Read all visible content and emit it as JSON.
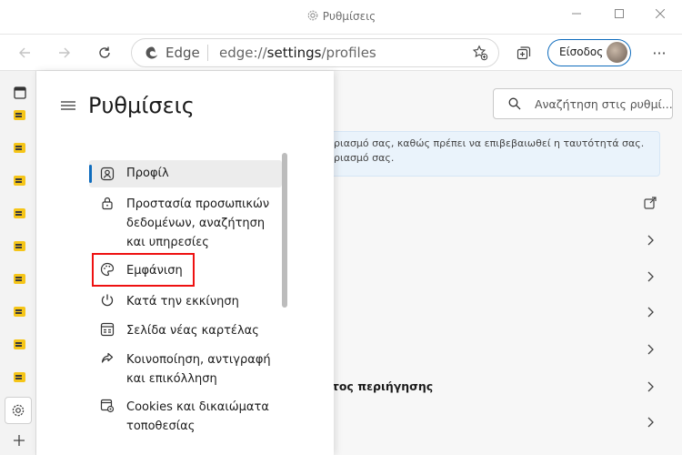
{
  "window": {
    "title": "Ρυθμίσεις"
  },
  "toolbar": {
    "address_brand": "Edge",
    "url_prefix": "edge://",
    "url_main": "settings",
    "url_suffix": "/profiles",
    "signin_label": "Είσοδος"
  },
  "settings": {
    "title": "Ρυθμίσεις",
    "search_placeholder": "Αναζήτηση στις ρυθμί...",
    "info_line1": "ριασμό σας, καθώς πρέπει να επιβεβαιωθεί η ταυτότητά σας.",
    "info_line2": "ριασμό σας.",
    "browsing_text": "ιτος περιήγησης"
  },
  "menu": {
    "items": [
      {
        "label": "Προφίλ",
        "icon": "profile-icon",
        "selected": true
      },
      {
        "label": "Προστασία προσωπικών δεδομένων, αναζήτηση και υπηρεσίες",
        "icon": "lock-icon"
      },
      {
        "label": "Εμφάνιση",
        "icon": "palette-icon",
        "highlighted": true
      },
      {
        "label": "Κατά την εκκίνηση",
        "icon": "power-icon"
      },
      {
        "label": "Σελίδα νέας καρτέλας",
        "icon": "new-tab-page-icon"
      },
      {
        "label": "Κοινοποίηση, αντιγραφή και επικόλληση",
        "icon": "share-icon"
      },
      {
        "label": "Cookies και δικαιώματα τοποθεσίας",
        "icon": "cookies-icon"
      }
    ]
  },
  "colors": {
    "accent": "#0f6cbd",
    "highlight_box": "#ee1111",
    "strip_icon": "#f5c518"
  }
}
